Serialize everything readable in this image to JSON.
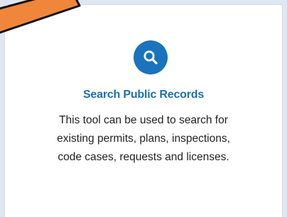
{
  "card": {
    "icon": "search-icon",
    "title": "Search Public Records",
    "description": "This tool can be used to search for\nexisting permits, plans, inspections,\ncode cases, requests and licenses."
  },
  "colors": {
    "accent": "#1a73bd",
    "title": "#1a6fb5",
    "body_text": "#222222",
    "page_bg": "#dfe7f2",
    "arrow_fill": "#f0863a",
    "arrow_outline": "#111111"
  }
}
